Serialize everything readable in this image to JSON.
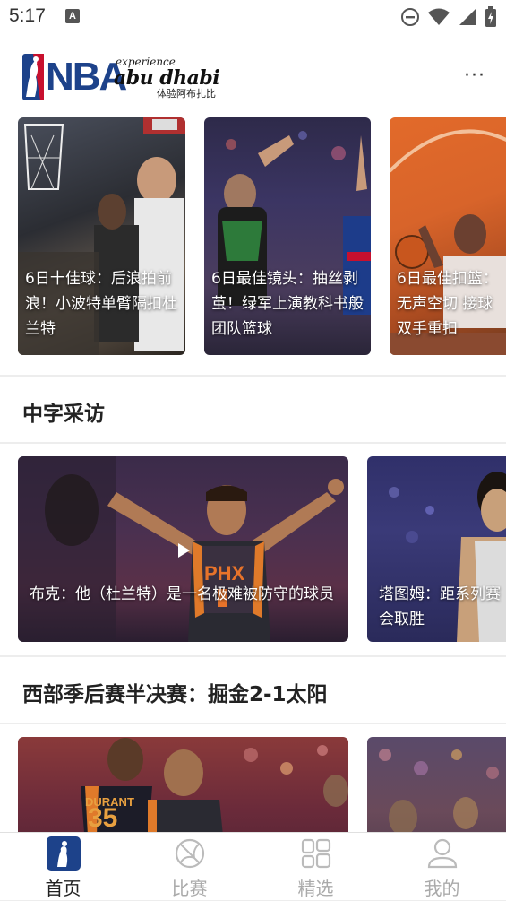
{
  "status_bar": {
    "time": "5:17",
    "notification_letter": "A"
  },
  "header": {
    "logo_text": "NBA",
    "sponsor_line1": "experience",
    "sponsor_line2": "abu dhabi",
    "sponsor_line3": "体验阿布扎比",
    "more_label": "···"
  },
  "top_cards": [
    {
      "caption": "6日十佳球：后浪拍前浪！小波特单臂隔扣杜兰特"
    },
    {
      "caption": "6日最佳镜头：抽丝剥茧！绿军上演教科书般团队篮球"
    },
    {
      "caption": "6日最佳扣篮：无声空切 接球双手重扣"
    }
  ],
  "section_interviews": {
    "title": "中字采访",
    "cards": [
      {
        "caption": "布克：他（杜兰特）是一名极难被防守的球员",
        "jersey_text": "PHX"
      },
      {
        "caption": "塔图姆：距系列赛会取胜"
      }
    ]
  },
  "section_series": {
    "title": "西部季后赛半决赛：掘金2-1太阳",
    "cards": [
      {
        "caption": "",
        "jersey_name": "DURANT",
        "jersey_number": "35"
      },
      {
        "caption": ""
      }
    ]
  },
  "tabs": [
    {
      "label": "首页",
      "active": true
    },
    {
      "label": "比赛",
      "active": false
    },
    {
      "label": "精选",
      "active": false
    },
    {
      "label": "我的",
      "active": false
    }
  ],
  "colors": {
    "nba_blue": "#1d428a",
    "nba_red": "#c8102e",
    "tab_inactive": "#aaaaaa",
    "background": "#ededed"
  }
}
